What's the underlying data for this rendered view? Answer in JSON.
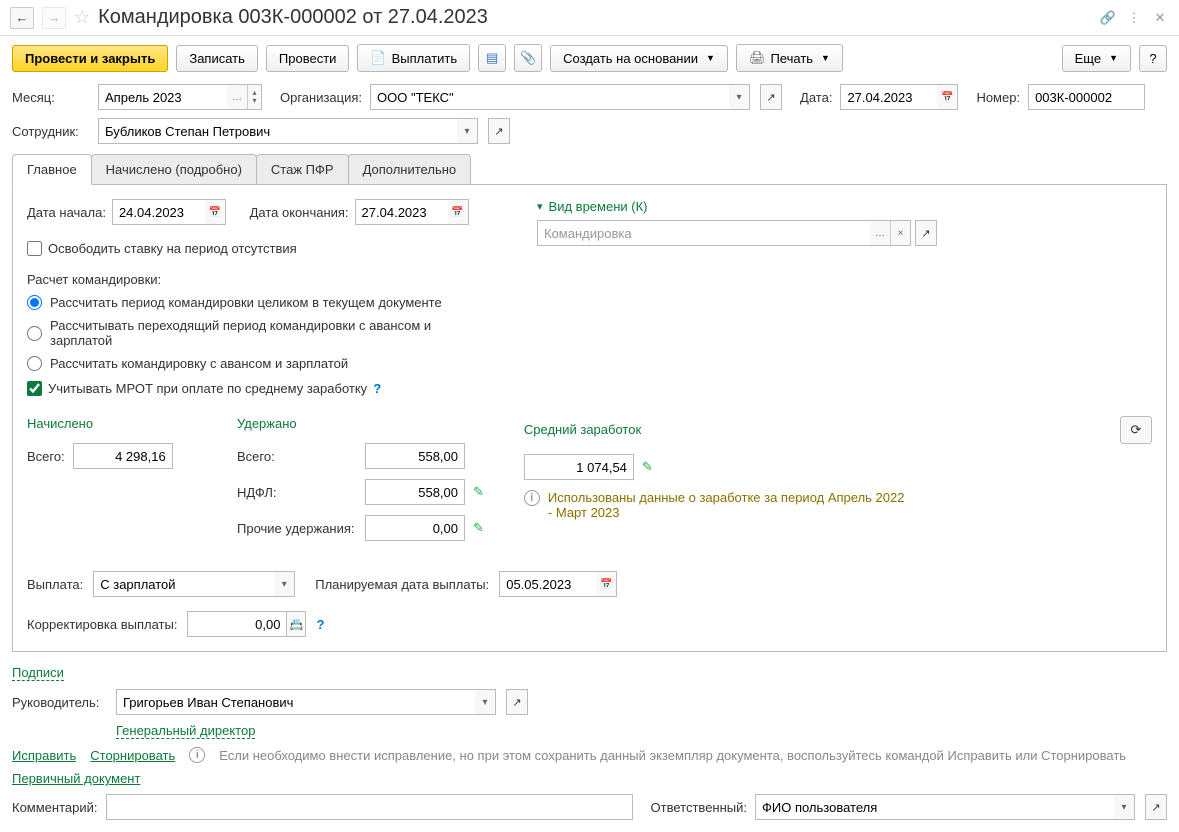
{
  "header": {
    "title": "Командировка 003К-000002 от 27.04.2023"
  },
  "toolbar": {
    "post_close": "Провести и закрыть",
    "save": "Записать",
    "post": "Провести",
    "pay": "Выплатить",
    "create_based": "Создать на основании",
    "print": "Печать",
    "more": "Еще",
    "help": "?"
  },
  "fields": {
    "month_label": "Месяц:",
    "month_value": "Апрель 2023",
    "org_label": "Организация:",
    "org_value": "ООО \"ТЕКС\"",
    "date_label": "Дата:",
    "date_value": "27.04.2023",
    "number_label": "Номер:",
    "number_value": "003К-000002",
    "employee_label": "Сотрудник:",
    "employee_value": "Бубликов Степан Петрович"
  },
  "tabs": {
    "main": "Главное",
    "accrued": "Начислено (подробно)",
    "pfr": "Стаж ПФР",
    "extra": "Дополнительно"
  },
  "main": {
    "start_label": "Дата начала:",
    "start_value": "24.04.2023",
    "end_label": "Дата окончания:",
    "end_value": "27.04.2023",
    "time_type_label": "Вид времени (К)",
    "time_type_value": "Командировка",
    "release_rate": "Освободить ставку на период отсутствия",
    "calc_label": "Расчет командировки:",
    "radio1": "Рассчитать период командировки целиком в текущем документе",
    "radio2": "Рассчитывать переходящий период командировки с авансом и зарплатой",
    "radio3": "Рассчитать командировку с авансом и зарплатой",
    "mrot": "Учитывать МРОТ при оплате по среднему заработку",
    "accrued_hdr": "Начислено",
    "total_label": "Всего:",
    "total_value": "4 298,16",
    "withheld_hdr": "Удержано",
    "withheld_total": "558,00",
    "ndfl_label": "НДФЛ:",
    "ndfl_value": "558,00",
    "other_label": "Прочие удержания:",
    "other_value": "0,00",
    "avg_hdr": "Средний заработок",
    "avg_value": "1 074,54",
    "info_text": "Использованы данные о заработке за период Апрель 2022 - Март 2023",
    "payout_label": "Выплата:",
    "payout_value": "С зарплатой",
    "plan_date_label": "Планируемая дата выплаты:",
    "plan_date_value": "05.05.2023",
    "corr_label": "Корректировка выплаты:",
    "corr_value": "0,00"
  },
  "bottom": {
    "signatures": "Подписи",
    "manager_label": "Руководитель:",
    "manager_value": "Григорьев Иван Степанович",
    "manager_title": "Генеральный директор",
    "fix": "Исправить",
    "storno": "Сторнировать",
    "fix_hint": "Если необходимо внести исправление, но при этом сохранить данный экземпляр документа, воспользуйтесь командой Исправить или Сторнировать",
    "primary_doc": "Первичный документ",
    "comment_label": "Комментарий:",
    "resp_label": "Ответственный:",
    "resp_value": "ФИО пользователя"
  }
}
